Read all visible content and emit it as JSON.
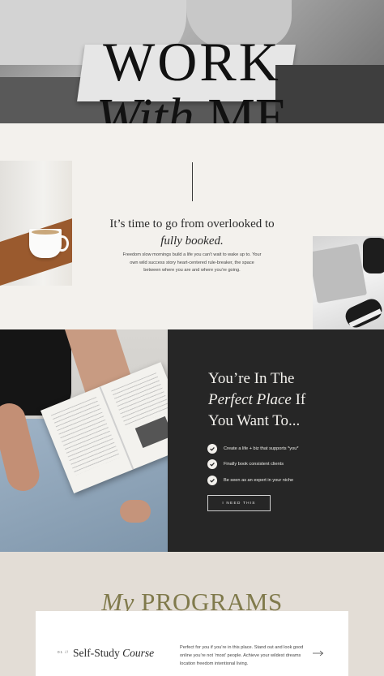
{
  "hero": {
    "title_line1": "WORK",
    "title_with": "With",
    "title_me": "ME"
  },
  "intro": {
    "heading_plain": "It’s time to go from overlooked to",
    "heading_italic": "fully booked.",
    "body": "Freedom slow mornings build a life you can’t wait to wake up to. Your own wild success story heart-centered rule-breaker, the space between where you are and where you’re going."
  },
  "perfect_place": {
    "heading_line1": "You’re In The",
    "heading_italic": "Perfect Place",
    "heading_if": "If",
    "heading_line3": "You Want To...",
    "items": [
      "Create a life + biz that supports *you*",
      "Finally book consistent clients",
      "Be seen as an expert in your niche"
    ],
    "cta_label": "I NEED THIS"
  },
  "programs": {
    "title_italic": "My",
    "title_plain": "PROGRAMS",
    "cards": [
      {
        "number": "01 //",
        "title_plain": "Self-Study",
        "title_italic": "Course",
        "description": "Perfect for you if you’re in this place. Stand out and look good online you’re not ‘most’ people. Achieve your wildest dreams location freedom intentional living."
      }
    ]
  },
  "colors": {
    "cream": "#f3f1ed",
    "dark": "#262626",
    "olive": "#807a4c",
    "taupe": "#e3ddd6"
  },
  "icons": [
    "check-icon",
    "arrow-right-icon"
  ]
}
